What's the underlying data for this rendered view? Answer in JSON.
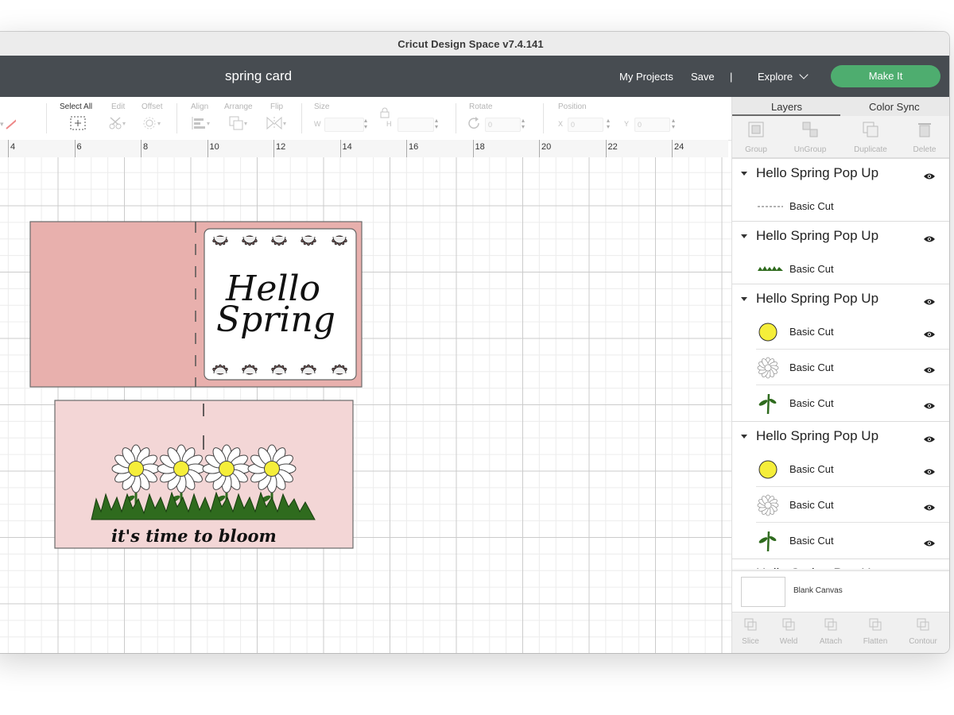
{
  "window": {
    "title": "Cricut Design Space  v7.4.141"
  },
  "appbar": {
    "project_name": "spring card",
    "my_projects": "My Projects",
    "save": "Save",
    "separator": "|",
    "explore": "Explore",
    "make_it": "Make It",
    "make_it_color": "#4ead6f"
  },
  "toolbar": {
    "select_all": "Select All",
    "edit": "Edit",
    "offset": "Offset",
    "align": "Align",
    "arrange": "Arrange",
    "flip": "Flip",
    "size": "Size",
    "w": "W",
    "h": "H",
    "rotate": "Rotate",
    "rotate_value": "0",
    "position": "Position",
    "x": "X",
    "x_value": "0",
    "y": "Y",
    "y_value": "0"
  },
  "ruler": {
    "ticks": [
      "4",
      "6",
      "8",
      "10",
      "12",
      "14",
      "16",
      "18",
      "20",
      "22",
      "24"
    ]
  },
  "canvas": {
    "card_top": {
      "line1": "Hello",
      "line2": "Spring",
      "color": "#e8b0ad"
    },
    "card_bottom": {
      "caption": "it's time to bloom",
      "color": "#f3d6d6"
    }
  },
  "panel": {
    "tabs": {
      "layers": "Layers",
      "color_sync": "Color Sync"
    },
    "actions": {
      "group": "Group",
      "ungroup": "UnGroup",
      "duplicate": "Duplicate",
      "delete": "Delete"
    },
    "groups": [
      {
        "title": "Hello Spring Pop Up",
        "items": [
          {
            "label": "Basic Cut",
            "thumb": "text-line-icon"
          }
        ]
      },
      {
        "title": "Hello Spring Pop Up",
        "items": [
          {
            "label": "Basic Cut",
            "thumb": "grass-icon"
          }
        ]
      },
      {
        "title": "Hello Spring Pop Up",
        "items": [
          {
            "label": "Basic Cut",
            "thumb": "yellow-circle-icon"
          },
          {
            "label": "Basic Cut",
            "thumb": "daisy-outline-icon"
          },
          {
            "label": "Basic Cut",
            "thumb": "stem-icon"
          }
        ]
      },
      {
        "title": "Hello Spring Pop Up",
        "items": [
          {
            "label": "Basic Cut",
            "thumb": "yellow-circle-icon"
          },
          {
            "label": "Basic Cut",
            "thumb": "daisy-outline-icon"
          },
          {
            "label": "Basic Cut",
            "thumb": "stem-icon"
          }
        ]
      },
      {
        "title": "Hello Spring Pop Up",
        "items": []
      }
    ],
    "blank_canvas": "Blank Canvas",
    "bottom_actions": {
      "slice": "Slice",
      "weld": "Weld",
      "attach": "Attach",
      "flatten": "Flatten",
      "contour": "Contour"
    }
  }
}
